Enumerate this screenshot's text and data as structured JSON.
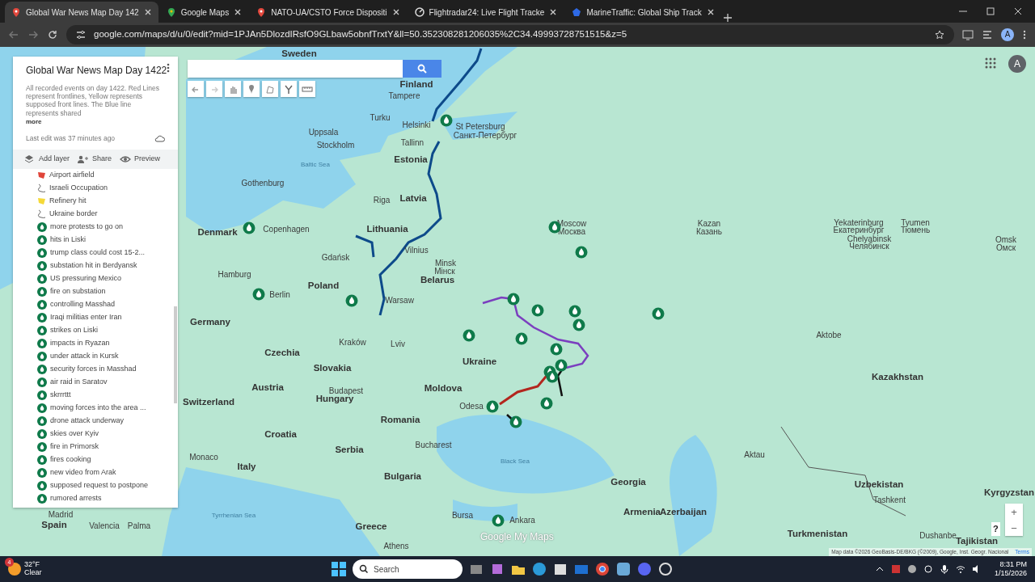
{
  "browser": {
    "tabs": [
      {
        "title": "Global War News Map Day 142",
        "selected": true,
        "kind": "mymaps"
      },
      {
        "title": "Google Maps",
        "selected": false,
        "kind": "maps"
      },
      {
        "title": "NATO-UA/CSTO Force Dispositi",
        "selected": false,
        "kind": "mymaps"
      },
      {
        "title": "Flightradar24: Live Flight Tracke",
        "selected": false,
        "kind": "radar"
      },
      {
        "title": "MarineTraffic: Global Ship Track",
        "selected": false,
        "kind": "ship"
      }
    ],
    "address": "google.com/maps/d/u/0/edit?mid=1PJAn5DlozdIRsfO9GLbaw5obnfTrxtY&ll=50.352308281206035%2C34.49993728751515&z=5",
    "profile": "A"
  },
  "panel": {
    "title": "Global War News Map Day 1422",
    "description": "All recorded events on day 1422. Red Lines represent frontlines, Yellow represents supposed front lines. The Blue line represents shared",
    "more": "more",
    "last_edit": "Last edit was 37 minutes ago",
    "actions": [
      "Add layer",
      "Share",
      "Preview"
    ],
    "layers": [
      {
        "label": "Airport airfield",
        "kind": "shape",
        "color": "#e0453a"
      },
      {
        "label": "Israeli Occupation",
        "kind": "line"
      },
      {
        "label": "Refinery hit",
        "kind": "shape",
        "color": "#f5d938"
      },
      {
        "label": "Ukraine border",
        "kind": "line"
      },
      {
        "label": "more protests to go on",
        "kind": "marker"
      },
      {
        "label": "hits in Liski",
        "kind": "marker"
      },
      {
        "label": "trump class could cost 15-2...",
        "kind": "marker"
      },
      {
        "label": "substation hit in Berdyansk",
        "kind": "marker"
      },
      {
        "label": "US pressuring Mexico",
        "kind": "marker"
      },
      {
        "label": "fire on substation",
        "kind": "marker"
      },
      {
        "label": "controlling Masshad",
        "kind": "marker"
      },
      {
        "label": "Iraqi militias enter Iran",
        "kind": "marker"
      },
      {
        "label": "strikes on Liski",
        "kind": "marker"
      },
      {
        "label": "impacts in Ryazan",
        "kind": "marker"
      },
      {
        "label": "under attack in Kursk",
        "kind": "marker"
      },
      {
        "label": "security forces in Masshad",
        "kind": "marker"
      },
      {
        "label": "air raid in Saratov",
        "kind": "marker"
      },
      {
        "label": "skrrrttt",
        "kind": "marker"
      },
      {
        "label": "moving forces into the area ...",
        "kind": "marker"
      },
      {
        "label": "drone attack underway",
        "kind": "marker"
      },
      {
        "label": "skies over Kyiv",
        "kind": "marker"
      },
      {
        "label": "fire in Primorsk",
        "kind": "marker"
      },
      {
        "label": "fires cooking",
        "kind": "marker"
      },
      {
        "label": "new video from Arak",
        "kind": "marker"
      },
      {
        "label": "supposed request to postpone",
        "kind": "marker"
      },
      {
        "label": "rumored arrests",
        "kind": "marker"
      }
    ]
  },
  "map": {
    "labels": [
      {
        "text": "Sweden",
        "kind": "country"
      },
      {
        "text": "Finland",
        "kind": "country"
      },
      {
        "text": "Tampere",
        "kind": "city"
      },
      {
        "text": "Turku",
        "kind": "city"
      },
      {
        "text": "Helsinki",
        "kind": "city"
      },
      {
        "text": "Uppsala",
        "kind": "city"
      },
      {
        "text": "Stockholm",
        "kind": "city"
      },
      {
        "text": "St Petersburg",
        "kind": "city"
      },
      {
        "text": "Санкт-Петербург",
        "kind": "city"
      },
      {
        "text": "Tallinn",
        "kind": "city"
      },
      {
        "text": "Estonia",
        "kind": "country"
      },
      {
        "text": "Baltic Sea",
        "kind": "sea"
      },
      {
        "text": "Gothenburg",
        "kind": "city"
      },
      {
        "text": "Riga",
        "kind": "city"
      },
      {
        "text": "Latvia",
        "kind": "country"
      },
      {
        "text": "Denmark",
        "kind": "country"
      },
      {
        "text": "Copenhagen",
        "kind": "city"
      },
      {
        "text": "Lithuania",
        "kind": "country"
      },
      {
        "text": "Vilnius",
        "kind": "city"
      },
      {
        "text": "Gdańsk",
        "kind": "city"
      },
      {
        "text": "Minsk",
        "kind": "city"
      },
      {
        "text": "Мінск",
        "kind": "city"
      },
      {
        "text": "Belarus",
        "kind": "country"
      },
      {
        "text": "Hamburg",
        "kind": "city"
      },
      {
        "text": "Poland",
        "kind": "country"
      },
      {
        "text": "Berlin",
        "kind": "city"
      },
      {
        "text": "Warsaw",
        "kind": "city"
      },
      {
        "text": "Moscow",
        "kind": "city"
      },
      {
        "text": "Москва",
        "kind": "city"
      },
      {
        "text": "Kazan",
        "kind": "city"
      },
      {
        "text": "Казань",
        "kind": "city"
      },
      {
        "text": "Yekaterinburg",
        "kind": "city"
      },
      {
        "text": "Екатеринбург",
        "kind": "city"
      },
      {
        "text": "Tyumen",
        "kind": "city"
      },
      {
        "text": "Тюмень",
        "kind": "city"
      },
      {
        "text": "Chelyabinsk",
        "kind": "city"
      },
      {
        "text": "Челябинск",
        "kind": "city"
      },
      {
        "text": "Omsk",
        "kind": "city"
      },
      {
        "text": "Омск",
        "kind": "city"
      },
      {
        "text": "Germany",
        "kind": "country"
      },
      {
        "text": "Kraków",
        "kind": "city"
      },
      {
        "text": "Lviv",
        "kind": "city"
      },
      {
        "text": "Ukraine",
        "kind": "country"
      },
      {
        "text": "Czechia",
        "kind": "country"
      },
      {
        "text": "Slovakia",
        "kind": "country"
      },
      {
        "text": "Austria",
        "kind": "country"
      },
      {
        "text": "Budapest",
        "kind": "city"
      },
      {
        "text": "Hungary",
        "kind": "country"
      },
      {
        "text": "Moldova",
        "kind": "country"
      },
      {
        "text": "Odesa",
        "kind": "city"
      },
      {
        "text": "Switzerland",
        "kind": "country"
      },
      {
        "text": "Romania",
        "kind": "country"
      },
      {
        "text": "Kazakhstan",
        "kind": "country"
      },
      {
        "text": "Aktobe",
        "kind": "city"
      },
      {
        "text": "Croatia",
        "kind": "country"
      },
      {
        "text": "Bucharest",
        "kind": "city"
      },
      {
        "text": "Serbia",
        "kind": "country"
      },
      {
        "text": "Black Sea",
        "kind": "sea"
      },
      {
        "text": "Italy",
        "kind": "country"
      },
      {
        "text": "Bulgaria",
        "kind": "country"
      },
      {
        "text": "Georgia",
        "kind": "country"
      },
      {
        "text": "Aktau",
        "kind": "city"
      },
      {
        "text": "Uzbekistan",
        "kind": "country"
      },
      {
        "text": "Kyrgyzstan",
        "kind": "country"
      },
      {
        "text": "Armenia",
        "kind": "country"
      },
      {
        "text": "Azerbaijan",
        "kind": "country"
      },
      {
        "text": "Turkmenistan",
        "kind": "country"
      },
      {
        "text": "Tajikistan",
        "kind": "country"
      },
      {
        "text": "Dushanbe",
        "kind": "city"
      },
      {
        "text": "Greece",
        "kind": "country"
      },
      {
        "text": "Tyrrhenian Sea",
        "kind": "sea"
      },
      {
        "text": "Spain",
        "kind": "country"
      },
      {
        "text": "Madrid",
        "kind": "city"
      },
      {
        "text": "Valencia",
        "kind": "city"
      },
      {
        "text": "Palma",
        "kind": "city"
      },
      {
        "text": "Athens",
        "kind": "city"
      },
      {
        "text": "Bursa",
        "kind": "city"
      },
      {
        "text": "Ankara",
        "kind": "city"
      },
      {
        "text": "Monaco",
        "kind": "city"
      },
      {
        "text": "Tashkent",
        "kind": "city"
      }
    ],
    "account": "A",
    "logo": "Google My Maps",
    "attribution": "Map data ©2026 GeoBasis-DE/BKG (©2009), Google, Inst. Geogr. Nacional",
    "terms": "Terms",
    "zoom_in": "+",
    "zoom_out": "−",
    "help": "?"
  },
  "taskbar": {
    "temperature": "32°F",
    "condition": "Clear",
    "badge": "4",
    "search_placeholder": "Search",
    "time": "8:31 PM",
    "date": "1/15/2026"
  }
}
